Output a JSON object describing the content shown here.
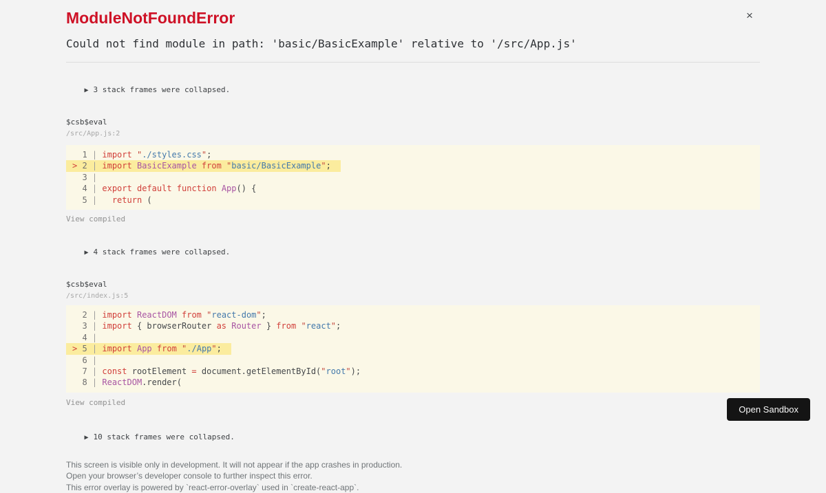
{
  "header": {
    "title": "ModuleNotFoundError",
    "message": "Could not find module in path: 'basic/BasicExample' relative to '/src/App.js'",
    "close_label": "×"
  },
  "collapsed": [
    {
      "icon": "▶",
      "label": "3 stack frames were collapsed."
    },
    {
      "icon": "▶",
      "label": "4 stack frames were collapsed."
    },
    {
      "icon": "▶",
      "label": "10 stack frames were collapsed."
    }
  ],
  "frames": [
    {
      "function": "$csb$eval",
      "location": "/src/App.js:2",
      "view_compiled": "View compiled",
      "code": [
        {
          "n": "1",
          "hl": false,
          "t": [
            [
              "kw",
              "import"
            ],
            [
              "pln",
              " "
            ],
            [
              "quo",
              "\""
            ],
            [
              "str",
              "./styles.css"
            ],
            [
              "quo",
              "\""
            ],
            [
              "pln",
              ";"
            ]
          ]
        },
        {
          "n": "2",
          "hl": true,
          "t": [
            [
              "kw",
              "import"
            ],
            [
              "pln",
              " "
            ],
            [
              "cls",
              "BasicExample"
            ],
            [
              "pln",
              " "
            ],
            [
              "kw",
              "from"
            ],
            [
              "pln",
              " "
            ],
            [
              "quo",
              "\""
            ],
            [
              "str",
              "basic/BasicExample"
            ],
            [
              "quo",
              "\""
            ],
            [
              "pln",
              ";"
            ]
          ]
        },
        {
          "n": "3",
          "hl": false,
          "t": []
        },
        {
          "n": "4",
          "hl": false,
          "t": [
            [
              "kw",
              "export"
            ],
            [
              "pln",
              " "
            ],
            [
              "kw",
              "default"
            ],
            [
              "pln",
              " "
            ],
            [
              "kw",
              "function"
            ],
            [
              "pln",
              " "
            ],
            [
              "cls",
              "App"
            ],
            [
              "pln",
              "() {"
            ]
          ]
        },
        {
          "n": "5",
          "hl": false,
          "t": [
            [
              "pln",
              "  "
            ],
            [
              "kw",
              "return"
            ],
            [
              "pln",
              " ("
            ]
          ]
        }
      ]
    },
    {
      "function": "$csb$eval",
      "location": "/src/index.js:5",
      "view_compiled": "View compiled",
      "code": [
        {
          "n": "2",
          "hl": false,
          "t": [
            [
              "kw",
              "import"
            ],
            [
              "pln",
              " "
            ],
            [
              "cls",
              "ReactDOM"
            ],
            [
              "pln",
              " "
            ],
            [
              "kw",
              "from"
            ],
            [
              "pln",
              " "
            ],
            [
              "quo",
              "\""
            ],
            [
              "str",
              "react-dom"
            ],
            [
              "quo",
              "\""
            ],
            [
              "pln",
              ";"
            ]
          ]
        },
        {
          "n": "3",
          "hl": false,
          "t": [
            [
              "kw",
              "import"
            ],
            [
              "pln",
              " { browserRouter "
            ],
            [
              "kw",
              "as"
            ],
            [
              "pln",
              " "
            ],
            [
              "cls",
              "Router"
            ],
            [
              "pln",
              " } "
            ],
            [
              "kw",
              "from"
            ],
            [
              "pln",
              " "
            ],
            [
              "quo",
              "\""
            ],
            [
              "str",
              "react"
            ],
            [
              "quo",
              "\""
            ],
            [
              "pln",
              ";"
            ]
          ]
        },
        {
          "n": "4",
          "hl": false,
          "t": []
        },
        {
          "n": "5",
          "hl": true,
          "t": [
            [
              "kw",
              "import"
            ],
            [
              "pln",
              " "
            ],
            [
              "cls",
              "App"
            ],
            [
              "pln",
              " "
            ],
            [
              "kw",
              "from"
            ],
            [
              "pln",
              " "
            ],
            [
              "quo",
              "\""
            ],
            [
              "str",
              "./App"
            ],
            [
              "quo",
              "\""
            ],
            [
              "pln",
              ";"
            ]
          ]
        },
        {
          "n": "6",
          "hl": false,
          "t": []
        },
        {
          "n": "7",
          "hl": false,
          "t": [
            [
              "kw",
              "const"
            ],
            [
              "pln",
              " rootElement "
            ],
            [
              "kw",
              "="
            ],
            [
              "pln",
              " document.getElementById("
            ],
            [
              "quo",
              "\""
            ],
            [
              "str",
              "root"
            ],
            [
              "quo",
              "\""
            ],
            [
              "pln",
              ");"
            ]
          ]
        },
        {
          "n": "8",
          "hl": false,
          "t": [
            [
              "cls",
              "ReactDOM"
            ],
            [
              "pln",
              ".render("
            ]
          ]
        }
      ]
    }
  ],
  "footer": {
    "lines": [
      "This screen is visible only in development. It will not appear if the app crashes in production.",
      "Open your browser’s developer console to further inspect this error.",
      "This error overlay is powered by `react-error-overlay` used in `create-react-app`."
    ]
  },
  "button": {
    "label": "Open Sandbox"
  },
  "colors": {
    "background": "#f3f3f3",
    "title_red": "#ce1126",
    "code_background": "#fbf8e7",
    "highlight_line": "#fbec9e",
    "keyword": "#d1403b",
    "class_name": "#a855a3",
    "string": "#4479ab",
    "plain_code": "#45484b",
    "muted_gray": "#929292",
    "button_background": "#141414"
  }
}
